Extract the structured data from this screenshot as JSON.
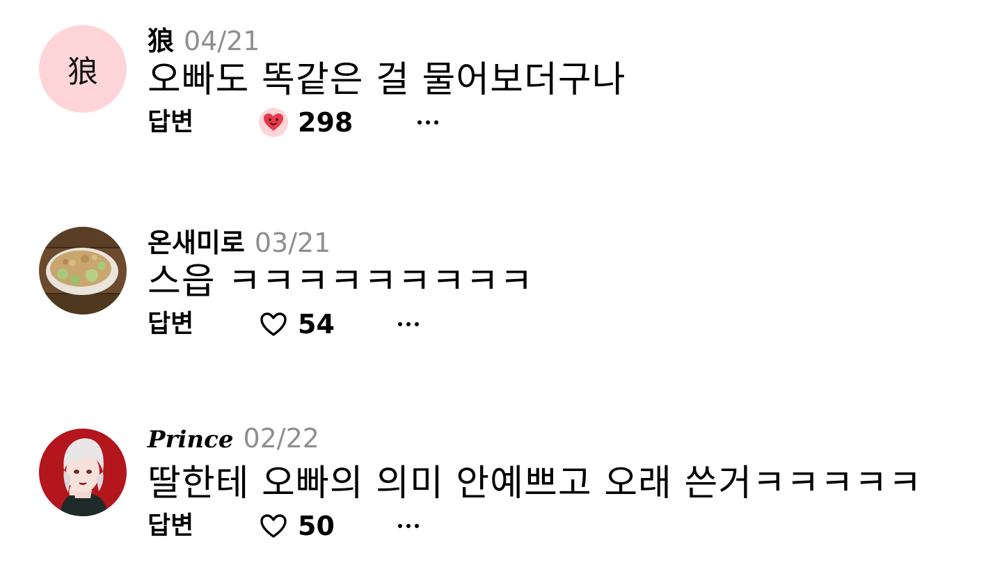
{
  "comments": [
    {
      "avatar_text": "狼",
      "username": "狼",
      "date": "04/21",
      "text": "오빠도 똑같은 걸 물어보더구나",
      "reply_label": "답변",
      "likes": "298",
      "liked": true,
      "more": "···"
    },
    {
      "username": "온새미로",
      "date": "03/21",
      "text": "스읍 ㅋㅋㅋㅋㅋㅋㅋㅋㅋ",
      "reply_label": "답변",
      "likes": "54",
      "liked": false,
      "more": "···"
    },
    {
      "username": "Prince",
      "date": "02/22",
      "text": "딸한테 오빠의 의미 안예쁘고 오래 쓴거ㅋㅋㅋㅋㅋ",
      "reply_label": "답변",
      "likes": "50",
      "liked": false,
      "more": "···"
    }
  ],
  "colors": {
    "avatar_bg": "#fdd5d9",
    "date": "#8e8e8e",
    "heart_red": "#e8394a"
  },
  "icons": {
    "liked": "heart-face-emoji-icon",
    "unliked": "heart-outline-icon",
    "more": "more-dots-icon"
  }
}
